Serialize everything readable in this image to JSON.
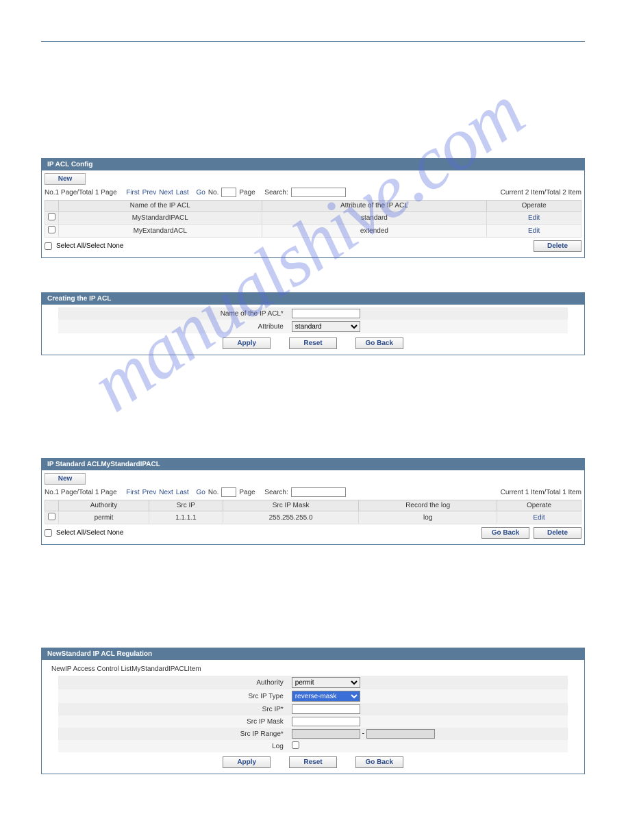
{
  "watermark": "manualshive.com",
  "panel1": {
    "title": "IP ACL Config",
    "new_label": "New",
    "pager": {
      "info": "No.1 Page/Total 1 Page",
      "first": "First",
      "prev": "Prev",
      "next": "Next",
      "last": "Last",
      "go": "Go",
      "no": "No.",
      "page": "Page",
      "search": "Search:",
      "count": "Current 2 Item/Total 2 Item"
    },
    "cols": {
      "name": "Name of the IP ACL",
      "attr": "Attribute of the IP ACL",
      "op": "Operate"
    },
    "rows": [
      {
        "name": "MyStandardIPACL",
        "attr": "standard",
        "op": "Edit"
      },
      {
        "name": "MyExtandardACL",
        "attr": "extended",
        "op": "Edit"
      }
    ],
    "select_label": "Select All/Select None",
    "delete_label": "Delete"
  },
  "panel2": {
    "title": "Creating the IP ACL",
    "name_label": "Name of the IP ACL*",
    "attr_label": "Attribute",
    "attr_value": "standard",
    "apply": "Apply",
    "reset": "Reset",
    "goback": "Go Back"
  },
  "panel3": {
    "title": "IP Standard ACLMyStandardIPACL",
    "new_label": "New",
    "pager": {
      "info": "No.1 Page/Total 1 Page",
      "first": "First",
      "prev": "Prev",
      "next": "Next",
      "last": "Last",
      "go": "Go",
      "no": "No.",
      "page": "Page",
      "search": "Search:",
      "count": "Current 1 Item/Total 1 Item"
    },
    "cols": {
      "auth": "Authority",
      "src": "Src IP",
      "mask": "Src IP Mask",
      "log": "Record the log",
      "op": "Operate"
    },
    "rows": [
      {
        "auth": "permit",
        "src": "1.1.1.1",
        "mask": "255.255.255.0",
        "log": "log",
        "op": "Edit"
      }
    ],
    "select_label": "Select All/Select None",
    "goback": "Go Back",
    "delete_label": "Delete"
  },
  "panel4": {
    "title": "NewStandard IP ACL Regulation",
    "note": "NewIP Access Control ListMyStandardIPACLItem",
    "fields": {
      "authority": "Authority",
      "authority_value": "permit",
      "srctype": "Src IP Type",
      "srctype_value": "reverse-mask",
      "srcip": "Src IP*",
      "mask": "Src IP Mask",
      "range": "Src IP Range*",
      "range_sep": "-",
      "log": "Log"
    },
    "apply": "Apply",
    "reset": "Reset",
    "goback": "Go Back"
  }
}
